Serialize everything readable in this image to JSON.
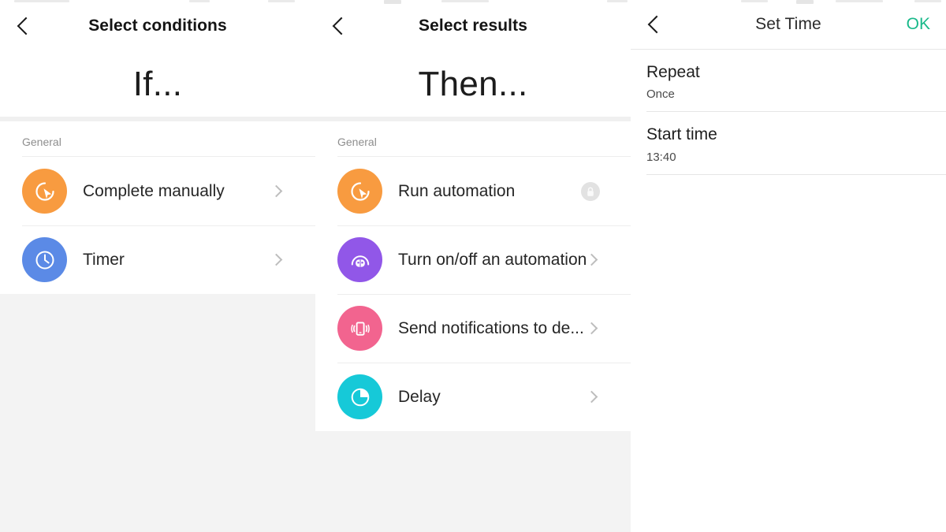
{
  "theme": {
    "accent_ok": "#19b98a",
    "icon_orange": "#f89b40",
    "icon_blue": "#5b8ae6",
    "icon_purple": "#9157e8",
    "icon_pink": "#f2648f",
    "icon_cyan": "#16c9d8",
    "page_background": "#f3f3f3",
    "card_background": "#ffffff"
  },
  "panels": {
    "conditions": {
      "nav": {
        "back_icon": "chevron-left-icon",
        "title": "Select conditions"
      },
      "heading": "If...",
      "group_label": "General",
      "rows": [
        {
          "label": "Complete manually",
          "icon": "cursor-click-icon",
          "icon_color": "#f89b40",
          "accessory": "chevron"
        },
        {
          "label": "Timer",
          "icon": "clock-icon",
          "icon_color": "#5b8ae6",
          "accessory": "chevron"
        }
      ]
    },
    "results": {
      "nav": {
        "back_icon": "chevron-left-icon",
        "title": "Select results"
      },
      "heading": "Then...",
      "group_label": "General",
      "rows": [
        {
          "label": "Run automation",
          "icon": "cursor-click-icon",
          "icon_color": "#f89b40",
          "accessory": "lock"
        },
        {
          "label": "Turn on/off an automation",
          "icon": "robot-device-icon",
          "icon_color": "#9157e8",
          "accessory": "chevron"
        },
        {
          "label": "Send notifications to de...",
          "icon": "phone-vibrate-icon",
          "icon_color": "#f2648f",
          "accessory": "chevron"
        },
        {
          "label": "Delay",
          "icon": "pie-clock-icon",
          "icon_color": "#16c9d8",
          "accessory": "chevron"
        }
      ]
    },
    "set_time": {
      "nav": {
        "back_icon": "chevron-left-icon",
        "title": "Set Time",
        "action_label": "OK"
      },
      "settings": [
        {
          "title": "Repeat",
          "value": "Once"
        },
        {
          "title": "Start time",
          "value": "13:40"
        }
      ]
    }
  }
}
